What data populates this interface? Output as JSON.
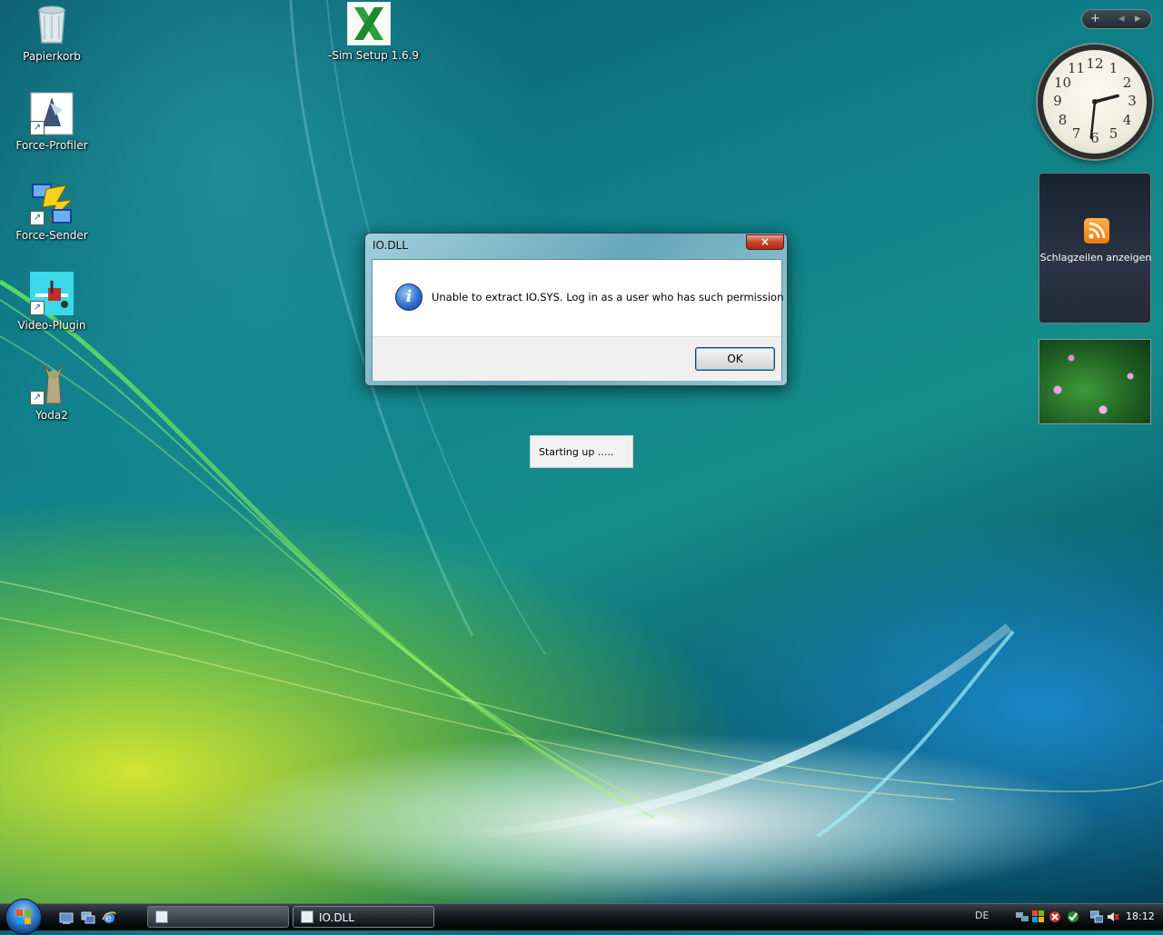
{
  "desktop": {
    "icons": [
      {
        "label": "Papierkorb",
        "icon": "recycle-bin-icon"
      },
      {
        "label": "Force-Profiler",
        "icon": "force-profiler-icon"
      },
      {
        "label": "Force-Sender",
        "icon": "force-sender-icon"
      },
      {
        "label": "Video-Plugin",
        "icon": "video-plugin-icon"
      },
      {
        "label": "Yoda2",
        "icon": "yoda-icon"
      },
      {
        "label": "-Sim Setup 1.6.9",
        "icon": "sim-setup-icon"
      }
    ]
  },
  "sidebar": {
    "toolbar": {
      "add": "+",
      "prev": "◂",
      "next": "▸"
    },
    "clock": {
      "numbers": [
        "12",
        "1",
        "2",
        "3",
        "4",
        "5",
        "6",
        "7",
        "8",
        "9",
        "10",
        "11"
      ],
      "hour": 2,
      "minute": 31
    },
    "feed": {
      "label": "Schlagzeilen anzeigen"
    }
  },
  "dialog": {
    "title": "IO.DLL",
    "close": "×",
    "message": "Unable to extract IO.SYS. Log in as a user who has such permission",
    "ok_label": "OK"
  },
  "startup": {
    "text": "Starting up ....."
  },
  "taskbar": {
    "buttons": [
      {
        "label": "",
        "active": false
      },
      {
        "label": "IO.DLL",
        "active": true
      }
    ],
    "language": "DE",
    "time": "18:12"
  },
  "colors": {
    "accent": "#2e7cd0",
    "close": "#c8442e",
    "info": "#2f6fcf"
  }
}
